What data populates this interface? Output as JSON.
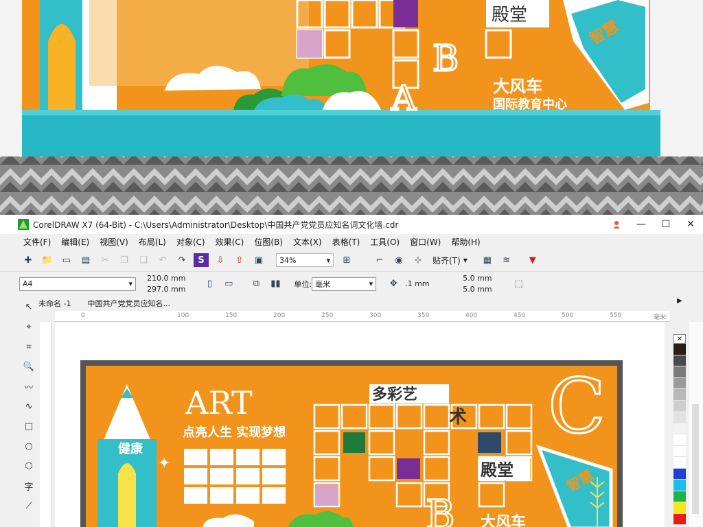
{
  "window": {
    "title": "CorelDRAW X7 (64-Bit) - C:\\Users\\Administrator\\Desktop\\中国共产党党员应知名词文化墙.cdr",
    "minimize": "—",
    "maximize": "☐",
    "close": "✕",
    "help_icon": "person-icon"
  },
  "menu": [
    "文件(F)",
    "编辑(E)",
    "视图(V)",
    "布局(L)",
    "对象(C)",
    "效果(C)",
    "位图(B)",
    "文本(X)",
    "表格(T)",
    "工具(O)",
    "窗口(W)",
    "帮助(H)"
  ],
  "toolbar": {
    "zoom_value": "34%",
    "snap_label": "贴齐(T)"
  },
  "properties": {
    "page_size": "A4",
    "width": "210.0 mm",
    "height": "297.0 mm",
    "units_label": "单位:",
    "units_value": "毫米",
    "nudge": ".1 mm",
    "dup_x": "5.0 mm",
    "dup_y": "5.0 mm"
  },
  "doc_tabs": [
    "未命名 -1",
    "中国共产党党员应知名..."
  ],
  "ruler": {
    "ticks": [
      "0",
      "100",
      "150",
      "200",
      "250",
      "300",
      "350",
      "400",
      "450",
      "500",
      "550",
      "毫米"
    ]
  },
  "design": {
    "art_title": "ART",
    "art_subtitle": "点亮人生  实现梦想",
    "health": "健康",
    "wisdom": "智慧",
    "colorful": "多彩艺",
    "art_char": "术",
    "palace": "殿堂",
    "letter_c": "C",
    "letter_a": "A",
    "letter_b": "B",
    "windmill": "大风车",
    "school": "国际教育中心"
  },
  "palette": [
    "#2a1c18",
    "#4a4a4a",
    "#7a7a7a",
    "#9a9a9a",
    "#b8b8b8",
    "#cfcfcf",
    "#e2e2e2",
    "#f2f2f2",
    "#ffffff",
    "#ffffff",
    "#ffffff",
    "#1f3fd6",
    "#19c0e6",
    "#1db34a",
    "#f7e61a",
    "#e81b1b"
  ]
}
